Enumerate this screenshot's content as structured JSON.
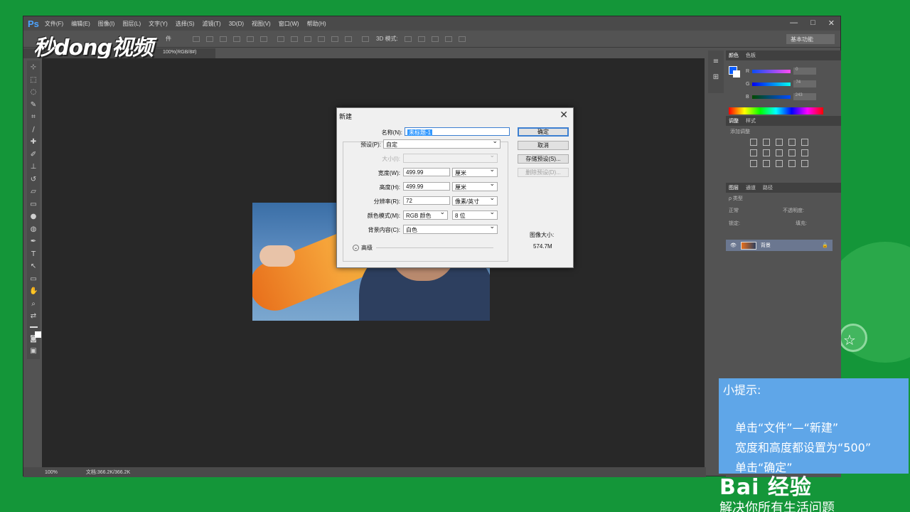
{
  "app": {
    "logo": "Ps",
    "menus": [
      "文件(F)",
      "编辑(E)",
      "图像(I)",
      "图层(L)",
      "文字(Y)",
      "选择(S)",
      "滤镜(T)",
      "3D(D)",
      "视图(V)",
      "窗口(W)",
      "帮助(H)"
    ],
    "window_controls": [
      "—",
      "□",
      "✕"
    ],
    "options_label": "3D 模式:",
    "options_left_label": "件",
    "workspace": "基本功能",
    "document_tab": "100%(RGB/8#)",
    "status_zoom": "100%",
    "status_doc": "文档:366.2K/366.2K"
  },
  "watermark": "秒dong视频",
  "panels": {
    "color_tabs": [
      "颜色",
      "色板"
    ],
    "rgb_labels": [
      "R",
      "G",
      "B"
    ],
    "rgb_values": [
      "0",
      "74",
      "243"
    ],
    "adjust_tabs": [
      "调整",
      "样式"
    ],
    "adjust_label": "添加调整",
    "layers_tabs": [
      "图层",
      "通道",
      "路径"
    ],
    "layer_filter": "ρ 类型",
    "blend_mode": "正常",
    "opacity_label": "不透明度:",
    "lock_label": "锁定:",
    "fill_label": "填充:",
    "layer_name": "背景"
  },
  "dialog": {
    "title": "新建",
    "close": "✕",
    "name_label": "名称(N):",
    "name_value": "未标题-1",
    "preset_label": "预设(P):",
    "preset_value": "自定",
    "size_label": "大小(I):",
    "width_label": "宽度(W):",
    "width_value": "499.99",
    "width_unit": "厘米",
    "height_label": "高度(H):",
    "height_value": "499.99",
    "height_unit": "厘米",
    "res_label": "分辨率(R):",
    "res_value": "72",
    "res_unit": "像素/英寸",
    "mode_label": "颜色模式(M):",
    "mode_value": "RGB 颜色",
    "bits_value": "8 位",
    "bg_label": "背景内容(C):",
    "bg_value": "白色",
    "advanced": "高级",
    "ok": "确定",
    "cancel": "取消",
    "save_preset": "存储预设(S)...",
    "delete_preset": "删除预设(D)...",
    "image_size_label": "图像大小:",
    "image_size_value": "574.7M"
  },
  "tip": {
    "title": "小提示:",
    "lines": [
      "单击“文件”—“新建”",
      "宽度和高度都设置为“500”",
      "单击“确定”"
    ]
  },
  "branding": {
    "logo": "Bai 经验",
    "slogan": "解决你所有生活问题"
  }
}
